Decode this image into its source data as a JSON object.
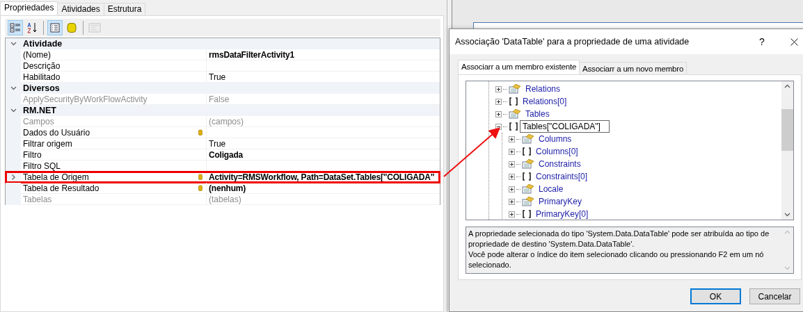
{
  "properties_panel": {
    "tabs": [
      {
        "label": "Propriedades",
        "selected": true
      },
      {
        "label": "Atividades",
        "selected": false
      },
      {
        "label": "Estrutura",
        "selected": false
      }
    ],
    "toolbar": [
      {
        "kind": "categorized",
        "pressed": true,
        "disabled": false
      },
      {
        "kind": "alphabetical",
        "pressed": false,
        "disabled": false
      },
      {
        "kind": "properties",
        "pressed": true,
        "disabled": false
      },
      {
        "kind": "database",
        "pressed": false,
        "disabled": false
      },
      {
        "kind": "pages",
        "pressed": false,
        "disabled": true
      }
    ],
    "grid": [
      {
        "kind": "category",
        "name": "Atividade",
        "expanded": true
      },
      {
        "kind": "property",
        "name": "(Nome)",
        "value": "rmsDataFilterActivity1",
        "modified": true,
        "disabled": false,
        "bound": false,
        "selected": false,
        "highlighted": false
      },
      {
        "kind": "property",
        "name": "Descrição",
        "disabled": false,
        "bound": false,
        "selected": false,
        "highlighted": false
      },
      {
        "kind": "property",
        "name": "Habilitado",
        "value": "True",
        "modified": false,
        "disabled": false,
        "bound": false,
        "selected": false,
        "highlighted": false
      },
      {
        "kind": "category",
        "name": "Diversos",
        "expanded": true
      },
      {
        "kind": "property",
        "name": "ApplySecurityByWorkFlowActivity",
        "value": "False",
        "modified": false,
        "disabled": true,
        "bound": false,
        "selected": false,
        "highlighted": false
      },
      {
        "kind": "category",
        "name": "RM.NET",
        "expanded": true
      },
      {
        "kind": "property",
        "name": "Campos",
        "value": "(campos)",
        "modified": false,
        "disabled": true,
        "bound": false,
        "selected": false,
        "highlighted": false
      },
      {
        "kind": "property",
        "name": "Dados do Usuário",
        "modified": false,
        "disabled": false,
        "bound": true,
        "selected": false,
        "highlighted": false
      },
      {
        "kind": "property",
        "name": "Filtrar origem",
        "value": "True",
        "modified": false,
        "disabled": false,
        "bound": false,
        "selected": false,
        "highlighted": false
      },
      {
        "kind": "property",
        "name": "Filtro",
        "value": "Coligada",
        "modified": true,
        "disabled": false,
        "bound": false,
        "selected": false,
        "highlighted": false
      },
      {
        "kind": "property",
        "name": "Filtro SQL",
        "disabled": false,
        "bound": false,
        "selected": false,
        "highlighted": false
      },
      {
        "kind": "property",
        "name": "Tabela de Origem",
        "value": "Activity=RMSWorkflow, Path=DataSet.Tables[\"COLIGADA\"",
        "modified": true,
        "disabled": false,
        "bound": true,
        "selected": true,
        "highlighted": true
      },
      {
        "kind": "property",
        "name": "Tabela de Resultado",
        "value": "(nenhum)",
        "modified": true,
        "disabled": false,
        "bound": true,
        "selected": false,
        "highlighted": false
      },
      {
        "kind": "property",
        "name": "Tabelas",
        "value": "(tabelas)",
        "modified": false,
        "disabled": true,
        "bound": false,
        "selected": false,
        "highlighted": false
      }
    ]
  },
  "dialog": {
    "title": "Associação 'DataTable' para a propriedade de uma atividade",
    "help": "?",
    "tabs": [
      {
        "label": "Associarr a um membro existente",
        "selected": true
      },
      {
        "label": "Associarr a um novo membro",
        "selected": false
      }
    ],
    "tree": [
      {
        "kind": "collection",
        "label": "Relations",
        "expanded": false,
        "editing": false
      },
      {
        "kind": "indexer",
        "label": "Relations[0]",
        "expanded": false,
        "editing": false
      },
      {
        "kind": "collection",
        "label": "Tables",
        "expanded": false,
        "editing": false
      },
      {
        "kind": "indexer",
        "label": "Tables[\"COLIGADA\"]",
        "expanded": true,
        "editing": true,
        "children": [
          {
            "kind": "collection",
            "label": "Columns",
            "expanded": false,
            "editing": false
          },
          {
            "kind": "indexer",
            "label": "Columns[0]",
            "expanded": false,
            "editing": false
          },
          {
            "kind": "collection",
            "label": "Constraints",
            "expanded": false,
            "editing": false
          },
          {
            "kind": "indexer",
            "label": "Constraints[0]",
            "expanded": false,
            "editing": false
          },
          {
            "kind": "collection",
            "label": "Locale",
            "expanded": false,
            "editing": false
          },
          {
            "kind": "collection",
            "label": "PrimaryKey",
            "expanded": false,
            "editing": false
          },
          {
            "kind": "indexer",
            "label": "PrimaryKey[0]",
            "expanded": false,
            "editing": false
          }
        ]
      }
    ],
    "description": [
      "A propriedade selecionada do tipo 'System.Data.DataTable' pode ser atribuída ao tipo de propriedade de destino 'System.Data.DataTable'.",
      "Você pode alterar o índice do item selecionado clicando ou pressionando F2 em um nó selecionado."
    ],
    "buttons": [
      {
        "label": "OK",
        "default": true
      },
      {
        "label": "Cancelar",
        "default": false
      }
    ]
  }
}
